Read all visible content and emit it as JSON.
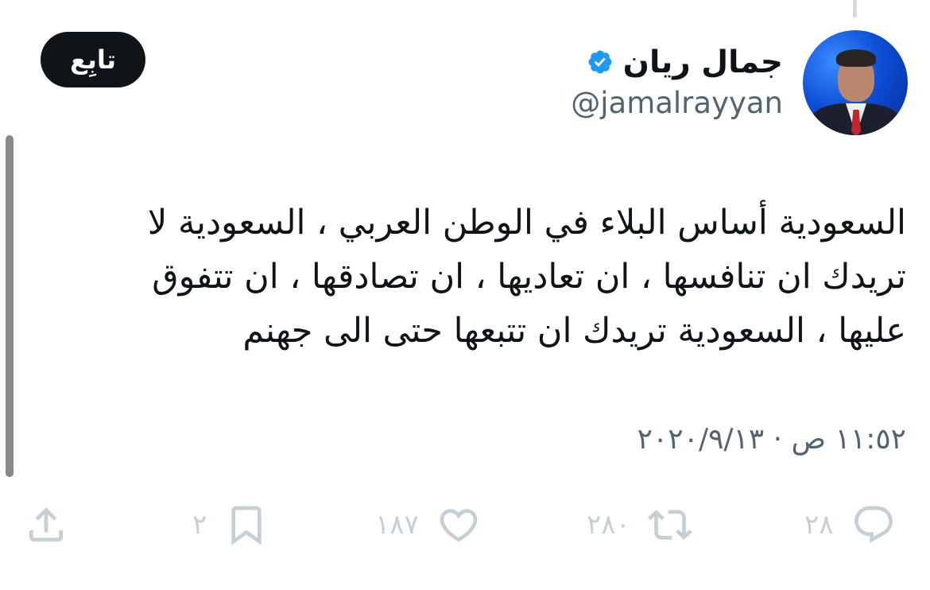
{
  "profile": {
    "display_name": "جمال ريان",
    "handle": "@jamalrayyan",
    "verified": true,
    "follow_label": "تابِع"
  },
  "tweet": {
    "lines": [
      "السعودية أساس البلاء في الوطن العربي ، السعودية لا",
      "تريدك ان تنافسها ، ان تعاديها ، ان تصادقها ، ان تتفوق",
      "عليها ، السعودية تريدك ان تتبعها حتى الى جهنم"
    ],
    "timestamp": "١١:٥٢ ص · ٢٠٢٠/٩/١٣"
  },
  "actions": {
    "reply_count": "٢٨",
    "retweet_count": "٢٨٠",
    "like_count": "١٨٧",
    "bookmark_count": "٢"
  },
  "icons": [
    "reply-icon",
    "retweet-icon",
    "like-icon",
    "bookmark-icon",
    "share-icon",
    "verified-badge-icon"
  ],
  "colors": {
    "text_primary": "#0f1419",
    "text_secondary": "#536471",
    "icon_muted": "#c4cfd6",
    "verified_blue": "#1d9bf0"
  }
}
